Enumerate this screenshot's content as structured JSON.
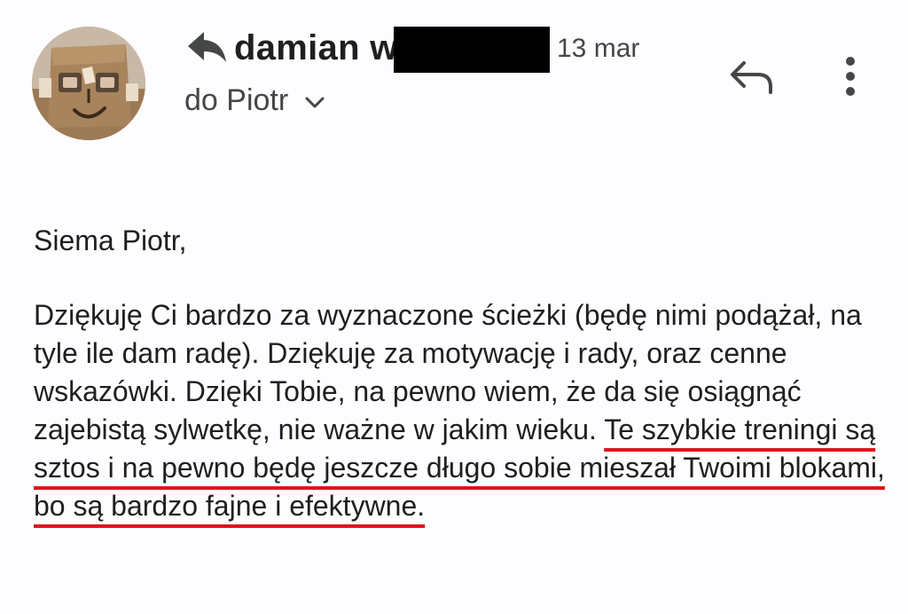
{
  "header": {
    "sender_name": "damian w",
    "date": "13 mar",
    "recipient_label": "do Piotr"
  },
  "icons": {
    "sender_arrow": "reply-arrow-icon",
    "recipient_toggle": "chevron-down-icon",
    "reply": "reply-icon",
    "more": "more-vert-icon"
  },
  "message": {
    "greeting": "Siema Piotr,",
    "paragraph_plain": "Dziękuję Ci bardzo za wyznaczone ścieżki (będę nimi podążał, na tyle ile dam radę). Dziękuję za motywację i rady, oraz cenne wskazówki. Dzięki Tobie, na pewno wiem, że da się osiągnąć zajebistą sylwetkę, nie ważne w jakim wieku. ",
    "paragraph_highlight": "Te szybkie treningi są sztos i na pewno będę jeszcze długo sobie mieszał Twoimi blokami, bo są bardzo fajne i efektywne."
  },
  "colors": {
    "background": "#fdfcff",
    "text": "#1f1f1f",
    "secondary_text": "#444746",
    "underline": "#e0141e",
    "redaction": "#000000"
  }
}
